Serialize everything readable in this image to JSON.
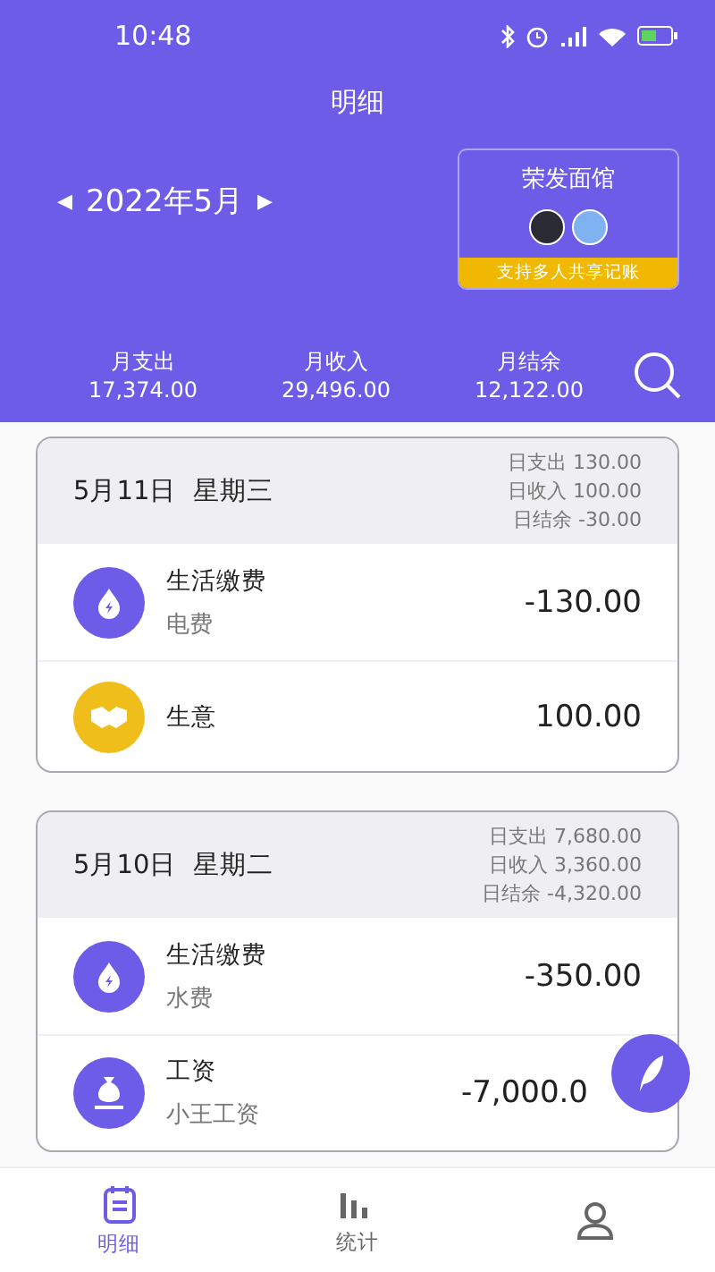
{
  "status_bar": {
    "time": "10:48"
  },
  "header": {
    "title": "明细",
    "month": "2022年5月",
    "prev": "◀",
    "next": "▶"
  },
  "share_card": {
    "name": "荣发面馆",
    "avatars": [
      {
        "kind": "dark"
      },
      {
        "kind": "blue"
      }
    ],
    "banner": "支持多人共享记账"
  },
  "summary": [
    {
      "label": "月支出",
      "value": "17,374.00"
    },
    {
      "label": "月收入",
      "value": "29,496.00"
    },
    {
      "label": "月结余",
      "value": "12,122.00"
    }
  ],
  "days": [
    {
      "date": "5月11日  星期三",
      "stats": [
        "日支出 130.00",
        "日收入 100.00",
        "日结余 -30.00"
      ],
      "entries": [
        {
          "kind": "utility",
          "category": "生活缴费",
          "note": "电费",
          "amount": "-130.00"
        },
        {
          "kind": "business",
          "category": "生意",
          "amount": "100.00"
        }
      ]
    },
    {
      "date": "5月10日  星期二",
      "stats": [
        "日支出 7,680.00",
        "日收入 3,360.00",
        "日结余 -4,320.00"
      ],
      "entries": [
        {
          "kind": "utility",
          "category": "生活缴费",
          "note": "水费",
          "amount": "-350.00"
        },
        {
          "kind": "salary",
          "category": "工资",
          "note": "小王工资",
          "amount": "-7,000.0"
        }
      ]
    }
  ],
  "nav": [
    {
      "kind": "list",
      "label": "明细",
      "selected": true
    },
    {
      "kind": "chart",
      "label": "统计",
      "selected": false
    },
    {
      "kind": "person",
      "selected": false
    }
  ]
}
